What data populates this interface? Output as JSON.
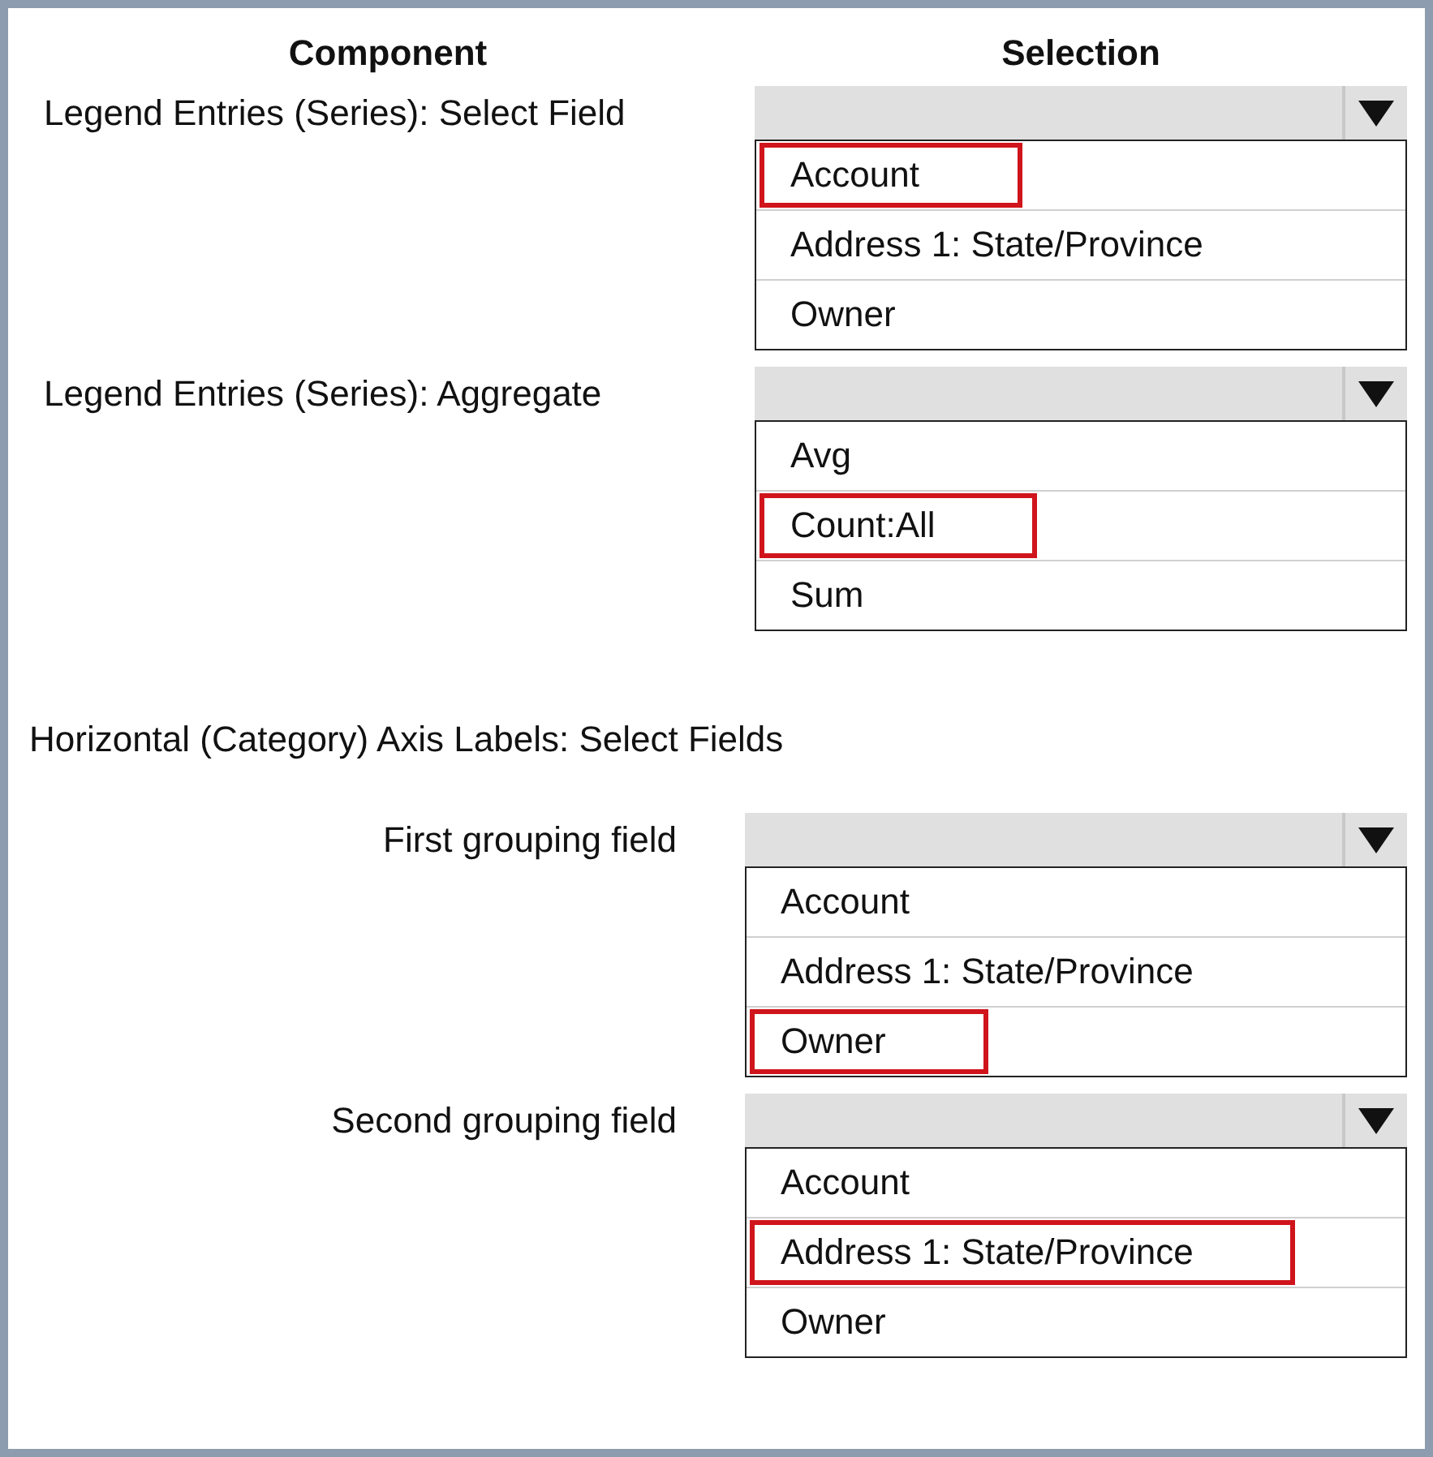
{
  "columns": [
    {
      "label": "Component"
    },
    {
      "label": "Selection"
    }
  ],
  "sections": [
    {
      "rows": [
        {
          "label": "Legend Entries (Series): Select Field",
          "options": [
            {
              "label": "Account",
              "selected": true
            },
            {
              "label": "Address 1: State/Province",
              "selected": false
            },
            {
              "label": "Owner",
              "selected": false
            }
          ]
        },
        {
          "label": "Legend Entries (Series): Aggregate",
          "options": [
            {
              "label": "Avg",
              "selected": false
            },
            {
              "label": "Count:All",
              "selected": true
            },
            {
              "label": "Sum",
              "selected": false
            }
          ]
        }
      ]
    },
    {
      "heading": "Horizontal (Category) Axis Labels: Select Fields",
      "rows": [
        {
          "label": "First grouping field",
          "options": [
            {
              "label": "Account",
              "selected": false
            },
            {
              "label": "Address 1: State/Province",
              "selected": false
            },
            {
              "label": "Owner",
              "selected": true
            }
          ]
        },
        {
          "label": "Second grouping field",
          "options": [
            {
              "label": "Account",
              "selected": false
            },
            {
              "label": "Address 1: State/Province",
              "selected": true
            },
            {
              "label": "Owner",
              "selected": false
            }
          ]
        }
      ]
    }
  ]
}
